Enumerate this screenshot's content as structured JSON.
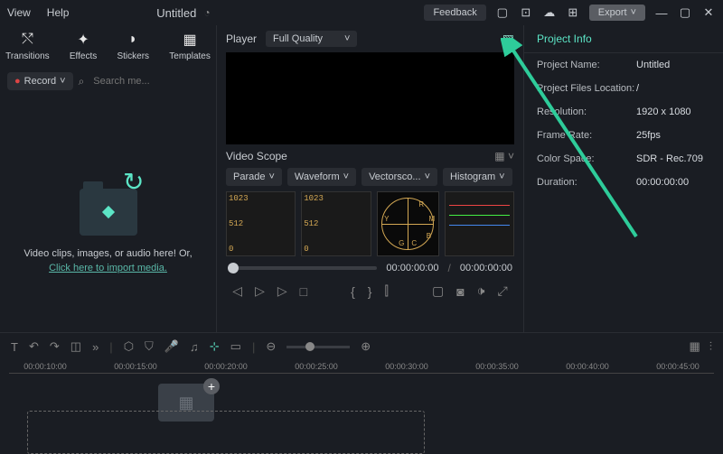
{
  "menu": [
    "View",
    "Help"
  ],
  "title": "Untitled",
  "feedback": "Feedback",
  "export": "Export",
  "tools": [
    {
      "label": "Transitions",
      "icon": "⤲"
    },
    {
      "label": "Effects",
      "icon": "✦"
    },
    {
      "label": "Stickers",
      "icon": "◗"
    },
    {
      "label": "Templates",
      "icon": "▦"
    }
  ],
  "record": "Record",
  "search_placeholder": "Search me...",
  "media_hint": "Video clips, images, or audio here! Or,",
  "media_link": "Click here to import media.",
  "player": {
    "label": "Player",
    "quality": "Full Quality"
  },
  "scope": {
    "title": "Video Scope",
    "tabs": [
      "Parade",
      "Waveform",
      "Vectorsco...",
      "Histogram"
    ],
    "labels": {
      "top": "1023",
      "mid": "512",
      "bot": "0"
    },
    "vector_letters": [
      "R",
      "M",
      "Y",
      "B",
      "G",
      "C"
    ]
  },
  "playback": {
    "current": "00:00:00:00",
    "total": "00:00:00:00"
  },
  "project_info": {
    "title": "Project Info",
    "rows": [
      {
        "label": "Project Name:",
        "value": "Untitled"
      },
      {
        "label": "Project Files Location:",
        "value": "/"
      },
      {
        "label": "Resolution:",
        "value": "1920 x 1080"
      },
      {
        "label": "Frame Rate:",
        "value": "25fps"
      },
      {
        "label": "Color Space:",
        "value": "SDR - Rec.709"
      },
      {
        "label": "Duration:",
        "value": "00:00:00:00"
      }
    ]
  },
  "timeline_ticks": [
    "00:00:10:00",
    "00:00:15:00",
    "00:00:20:00",
    "00:00:25:00",
    "00:00:30:00",
    "00:00:35:00",
    "00:00:40:00",
    "00:00:45:00"
  ]
}
